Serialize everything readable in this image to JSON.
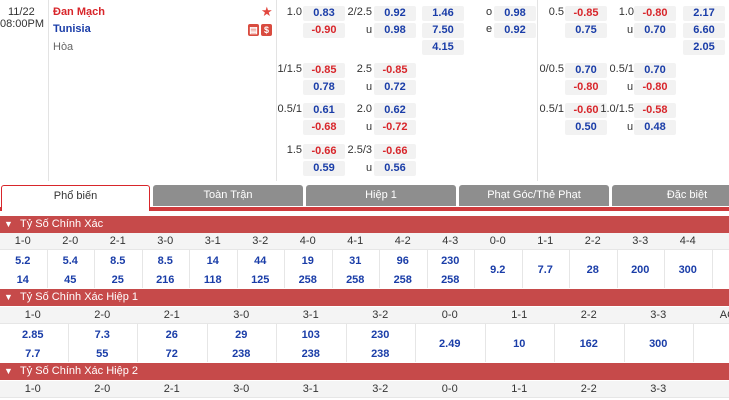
{
  "match": {
    "date": "11/22",
    "time": "08:00PM",
    "home": "Đan Mạch",
    "away": "Tunisia",
    "draw": "Hòa",
    "icons": [
      "star-icon",
      "calendar-icon",
      "dollar-icon"
    ]
  },
  "hdp": [
    {
      "h": "1.0",
      "a": "0.83",
      "b": "-0.90"
    },
    {
      "h": "1/1.5",
      "a": "-0.85",
      "b": "0.78"
    },
    {
      "h": "0.5/1",
      "a": "0.61",
      "b": "-0.68"
    },
    {
      "h": "1.5",
      "a": "-0.66",
      "b": "0.59"
    }
  ],
  "ou": [
    {
      "h": "2/2.5",
      "a": "0.92",
      "u": "u",
      "b": "0.98"
    },
    {
      "h": "2.5",
      "a": "-0.85",
      "u": "u",
      "b": "0.72"
    },
    {
      "h": "2.0",
      "a": "0.62",
      "u": "u",
      "b": "-0.72"
    },
    {
      "h": "2.5/3",
      "a": "-0.66",
      "u": "u",
      "b": "0.56"
    }
  ],
  "x12": [
    "1.46",
    "7.50",
    "4.15"
  ],
  "oe": [
    {
      "l": "o",
      "v": "0.98"
    },
    {
      "l": "e",
      "v": "0.92"
    }
  ],
  "h1_hdp": [
    {
      "h": "0.5",
      "a": "-0.85",
      "b": "0.75"
    },
    {
      "h": "0/0.5",
      "a": "0.70",
      "b": "-0.80"
    },
    {
      "h": "0.5/1",
      "a": "-0.60",
      "b": "0.50"
    }
  ],
  "h1_ou": [
    {
      "h": "1.0",
      "a": "-0.80",
      "u": "u",
      "b": "0.70"
    },
    {
      "h": "0.5/1",
      "a": "0.70",
      "u": "u",
      "b": "-0.80"
    },
    {
      "h": "1.0/1.5",
      "a": "-0.58",
      "u": "u",
      "b": "0.48"
    }
  ],
  "h1_x12": [
    "2.17",
    "6.60",
    "2.05"
  ],
  "tabs": [
    "Phổ biến",
    "Toàn Trận",
    "Hiệp 1",
    "Phạt Góc/Thẻ Phạt",
    "Đặc biệt"
  ],
  "sections": {
    "s1": {
      "title": "Tỷ Số Chính Xác",
      "scores": [
        "1-0",
        "2-0",
        "2-1",
        "3-0",
        "3-1",
        "3-2",
        "4-0",
        "4-1",
        "4-2",
        "4-3",
        "0-0",
        "1-1",
        "2-2",
        "3-3",
        "4-4"
      ],
      "row1": [
        "5.2",
        "5.4",
        "8.5",
        "8.5",
        "14",
        "44",
        "19",
        "31",
        "96",
        "230"
      ],
      "row2": [
        "14",
        "45",
        "25",
        "216",
        "118",
        "125",
        "258",
        "258",
        "258",
        "258"
      ],
      "draws": [
        "9.2",
        "7.7",
        "28",
        "200",
        "300"
      ]
    },
    "s2": {
      "title": "Tỷ Số Chính Xác Hiệp 1",
      "scores": [
        "1-0",
        "2-0",
        "2-1",
        "3-0",
        "3-1",
        "3-2",
        "0-0",
        "1-1",
        "2-2",
        "3-3",
        "AO"
      ],
      "row1": [
        "2.85",
        "7.3",
        "26",
        "29",
        "103",
        "230"
      ],
      "row2": [
        "7.7",
        "55",
        "72",
        "238",
        "238",
        "238"
      ],
      "draws": [
        "2.49",
        "10",
        "162",
        "300"
      ]
    },
    "s3": {
      "title": "Tỷ Số Chính Xác Hiệp 2",
      "scores": [
        "1-0",
        "2-0",
        "2-1",
        "3-0",
        "3-1",
        "3-2",
        "0-0",
        "1-1",
        "2-2",
        "3-3"
      ]
    }
  }
}
